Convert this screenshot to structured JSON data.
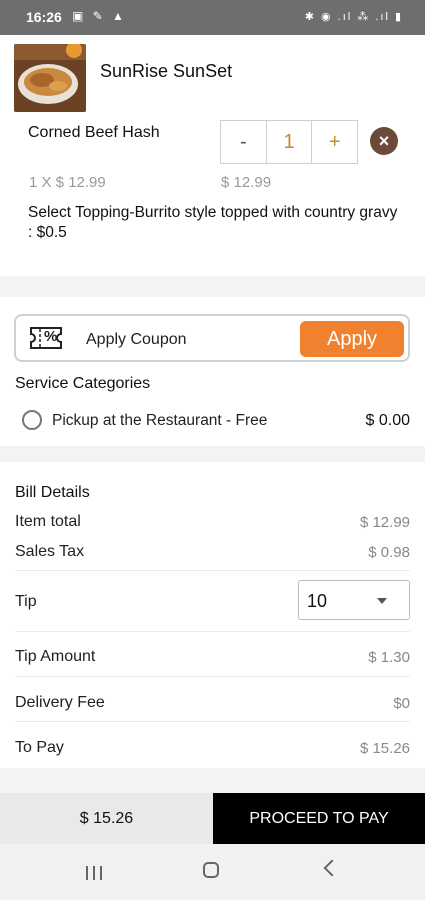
{
  "status_bar": {
    "time": "16:26",
    "left_icons": "▣ ✎ ▲",
    "right_icons": "✱ ◉ .ıl ⁂ .ıl ▮"
  },
  "cart": {
    "restaurant_name": "SunRise SunSet",
    "item": {
      "name": "Corned Beef Hash",
      "minus_label": "-",
      "quantity": "1",
      "plus_label": "+",
      "remove_icon": "close-icon",
      "unit_price": "1 X $ 12.99",
      "line_price": "$ 12.99",
      "topping": "Select Topping-Burrito style topped with country gravy : $0.5"
    }
  },
  "coupon": {
    "label": "Apply Coupon",
    "button": "Apply",
    "icon_glyph": "%",
    "accent": "#f0822f"
  },
  "service": {
    "title": "Service Categories",
    "option_label": "Pickup at the Restaurant - Free",
    "option_price": "$ 0.00"
  },
  "bill": {
    "title": "Bill Details",
    "item_total_label": "Item total",
    "item_total_value": "$ 12.99",
    "sales_tax_label": "Sales Tax",
    "sales_tax_value": "$ 0.98",
    "tip_label": "Tip",
    "tip_selected": "10",
    "tip_amount_label": "Tip Amount",
    "tip_amount_value": "$ 1.30",
    "delivery_fee_label": "Delivery Fee",
    "delivery_fee_value": "$0",
    "to_pay_label": "To Pay",
    "to_pay_value": "$ 15.26"
  },
  "footer": {
    "total": "$ 15.26",
    "proceed_label": "PROCEED TO PAY"
  }
}
